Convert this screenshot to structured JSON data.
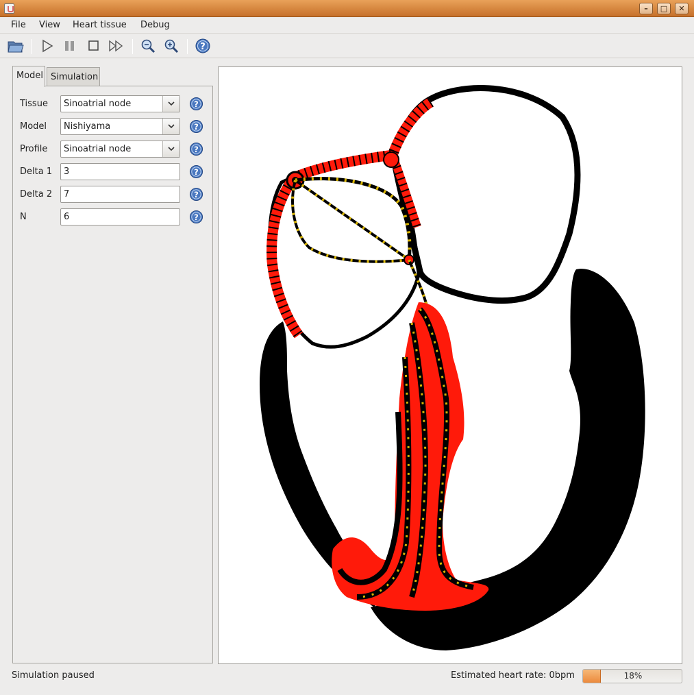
{
  "window": {
    "title": "",
    "controls": [
      "minimize-icon",
      "maximize-icon",
      "close-icon"
    ]
  },
  "menu": {
    "file": "File",
    "view": "View",
    "heart_tissue": "Heart tissue",
    "debug": "Debug"
  },
  "toolbar": {
    "icons": [
      "open-folder-icon",
      "play-icon",
      "pause-icon",
      "stop-icon",
      "fast-forward-icon",
      "zoom-out-icon",
      "zoom-in-icon",
      "help-icon"
    ]
  },
  "tabs": {
    "model": "Model",
    "simulation": "Simulation",
    "active": "Model"
  },
  "model_panel": {
    "tissue_label": "Tissue",
    "tissue_value": "Sinoatrial node",
    "model_label": "Model",
    "model_value": "Nishiyama",
    "profile_label": "Profile",
    "profile_value": "Sinoatrial node",
    "delta1_label": "Delta 1",
    "delta1_value": "3",
    "delta2_label": "Delta 2",
    "delta2_value": "7",
    "n_label": "N",
    "n_value": "6"
  },
  "status": {
    "message": "Simulation paused",
    "heart_rate": "Estimated heart rate: 0bpm",
    "progress_text": "18%",
    "progress_fraction": 0.18
  },
  "colors": {
    "titlebar": "#d4823c",
    "activation": "#ff1a0a",
    "tissue": "#000000",
    "conduction_path": "#d8b400"
  }
}
